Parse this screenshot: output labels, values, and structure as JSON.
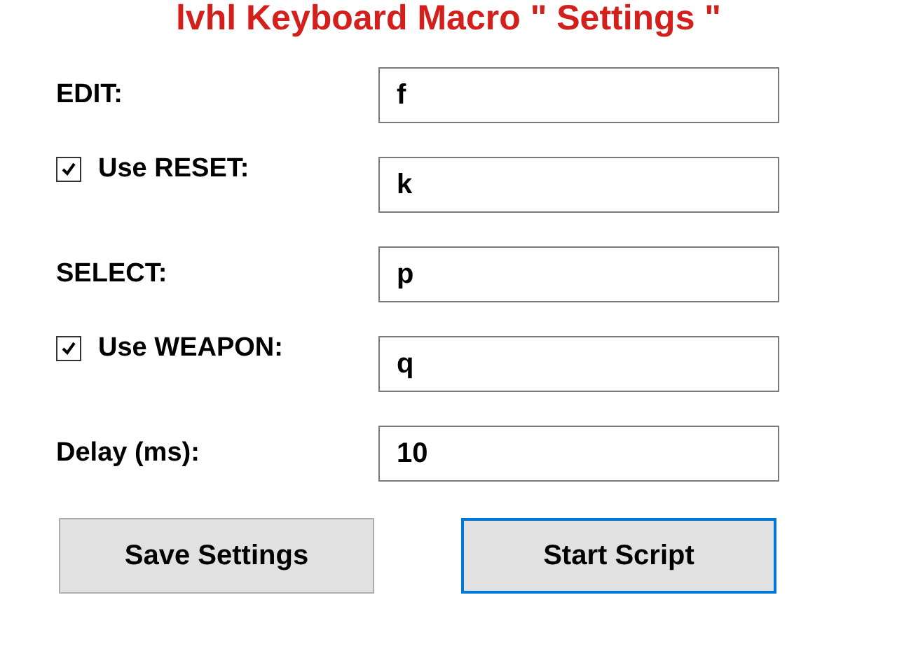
{
  "title": "lvhl Keyboard Macro \" Settings \"",
  "fields": [
    {
      "kind": "plain",
      "label": "EDIT:",
      "value": "f"
    },
    {
      "kind": "checkbox",
      "label": "Use RESET:",
      "checked": true,
      "value": "k"
    },
    {
      "kind": "plain",
      "label": "SELECT:",
      "value": "p"
    },
    {
      "kind": "checkbox",
      "label": "Use WEAPON:",
      "checked": true,
      "value": "q"
    },
    {
      "kind": "plain",
      "label": "Delay (ms):",
      "value": "10"
    }
  ],
  "buttons": [
    {
      "label": "Save Settings",
      "focused": false
    },
    {
      "label": "Start Script",
      "focused": true
    }
  ]
}
